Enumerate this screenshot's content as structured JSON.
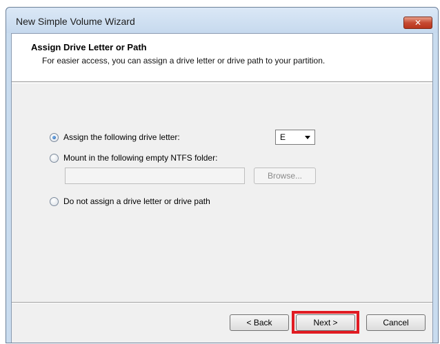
{
  "window": {
    "title": "New Simple Volume Wizard",
    "close_label": "✕"
  },
  "header": {
    "title": "Assign Drive Letter or Path",
    "subtitle": "For easier access, you can assign a drive letter or drive path to your partition."
  },
  "options": [
    {
      "label": "Assign the following drive letter:",
      "checked": true
    },
    {
      "label": "Mount in the following empty NTFS folder:",
      "checked": false
    },
    {
      "label": "Do not assign a drive letter or drive path",
      "checked": false
    }
  ],
  "drive_letter": {
    "value": "E"
  },
  "folder_path": {
    "value": ""
  },
  "browse_label": "Browse...",
  "buttons": {
    "back": "< Back",
    "next": "Next >",
    "cancel": "Cancel"
  },
  "colors": {
    "highlight": "#e11b22"
  }
}
